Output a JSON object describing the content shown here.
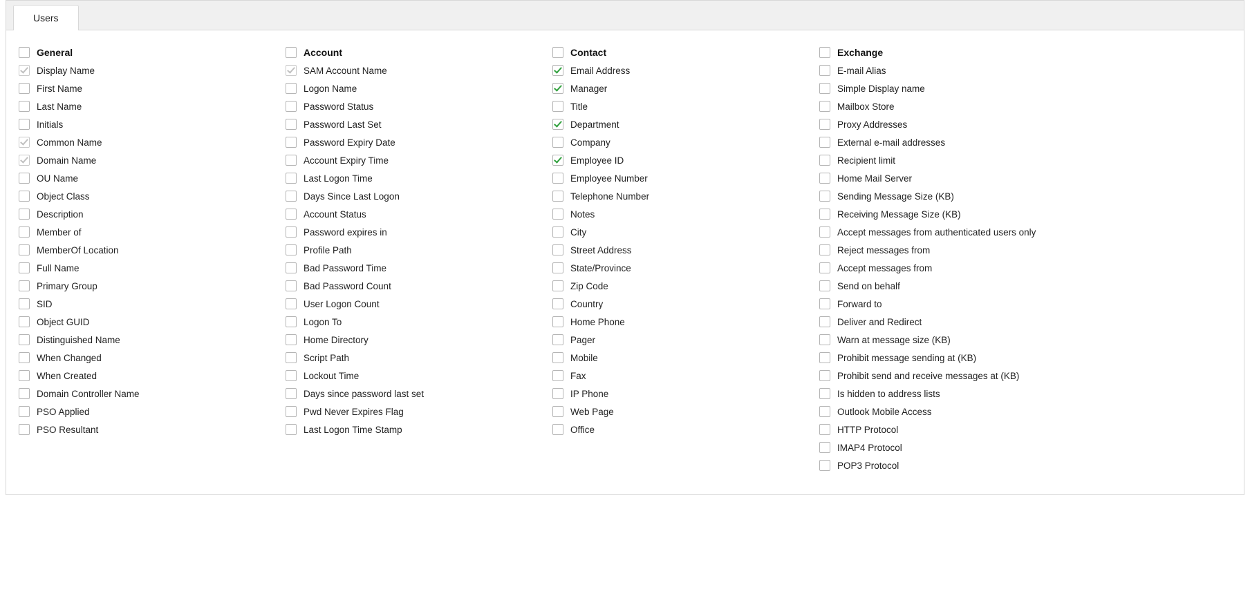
{
  "tab": {
    "label": "Users"
  },
  "columns": [
    {
      "key": "general",
      "title": "General",
      "items": [
        {
          "label": "Display Name",
          "state": "locked"
        },
        {
          "label": "First Name",
          "state": "unchecked"
        },
        {
          "label": "Last Name",
          "state": "unchecked"
        },
        {
          "label": "Initials",
          "state": "unchecked"
        },
        {
          "label": "Common Name",
          "state": "locked"
        },
        {
          "label": "Domain Name",
          "state": "locked"
        },
        {
          "label": "OU Name",
          "state": "unchecked"
        },
        {
          "label": "Object Class",
          "state": "unchecked"
        },
        {
          "label": "Description",
          "state": "unchecked"
        },
        {
          "label": "Member of",
          "state": "unchecked"
        },
        {
          "label": "MemberOf Location",
          "state": "unchecked"
        },
        {
          "label": "Full Name",
          "state": "unchecked"
        },
        {
          "label": "Primary Group",
          "state": "unchecked"
        },
        {
          "label": "SID",
          "state": "unchecked"
        },
        {
          "label": "Object GUID",
          "state": "unchecked"
        },
        {
          "label": "Distinguished Name",
          "state": "unchecked"
        },
        {
          "label": "When Changed",
          "state": "unchecked"
        },
        {
          "label": "When Created",
          "state": "unchecked"
        },
        {
          "label": "Domain Controller Name",
          "state": "unchecked"
        },
        {
          "label": "PSO Applied",
          "state": "unchecked"
        },
        {
          "label": "PSO Resultant",
          "state": "unchecked"
        }
      ]
    },
    {
      "key": "account",
      "title": "Account",
      "items": [
        {
          "label": "SAM Account Name",
          "state": "locked"
        },
        {
          "label": "Logon Name",
          "state": "unchecked"
        },
        {
          "label": "Password Status",
          "state": "unchecked"
        },
        {
          "label": "Password Last Set",
          "state": "unchecked"
        },
        {
          "label": "Password Expiry Date",
          "state": "unchecked"
        },
        {
          "label": "Account Expiry Time",
          "state": "unchecked"
        },
        {
          "label": "Last Logon Time",
          "state": "unchecked"
        },
        {
          "label": "Days Since Last Logon",
          "state": "unchecked"
        },
        {
          "label": "Account Status",
          "state": "unchecked"
        },
        {
          "label": "Password expires in",
          "state": "unchecked"
        },
        {
          "label": "Profile Path",
          "state": "unchecked"
        },
        {
          "label": "Bad Password Time",
          "state": "unchecked"
        },
        {
          "label": "Bad Password Count",
          "state": "unchecked"
        },
        {
          "label": "User Logon Count",
          "state": "unchecked"
        },
        {
          "label": "Logon To",
          "state": "unchecked"
        },
        {
          "label": "Home Directory",
          "state": "unchecked"
        },
        {
          "label": "Script Path",
          "state": "unchecked"
        },
        {
          "label": "Lockout Time",
          "state": "unchecked"
        },
        {
          "label": "Days since password last set",
          "state": "unchecked"
        },
        {
          "label": "Pwd Never Expires Flag",
          "state": "unchecked"
        },
        {
          "label": "Last Logon Time Stamp",
          "state": "unchecked"
        }
      ]
    },
    {
      "key": "contact",
      "title": "Contact",
      "items": [
        {
          "label": "Email Address",
          "state": "checked"
        },
        {
          "label": "Manager",
          "state": "checked"
        },
        {
          "label": "Title",
          "state": "unchecked"
        },
        {
          "label": "Department",
          "state": "checked"
        },
        {
          "label": "Company",
          "state": "unchecked"
        },
        {
          "label": "Employee ID",
          "state": "checked"
        },
        {
          "label": "Employee Number",
          "state": "unchecked"
        },
        {
          "label": "Telephone Number",
          "state": "unchecked"
        },
        {
          "label": "Notes",
          "state": "unchecked"
        },
        {
          "label": "City",
          "state": "unchecked"
        },
        {
          "label": "Street Address",
          "state": "unchecked"
        },
        {
          "label": "State/Province",
          "state": "unchecked"
        },
        {
          "label": "Zip Code",
          "state": "unchecked"
        },
        {
          "label": "Country",
          "state": "unchecked"
        },
        {
          "label": "Home Phone",
          "state": "unchecked"
        },
        {
          "label": "Pager",
          "state": "unchecked"
        },
        {
          "label": "Mobile",
          "state": "unchecked"
        },
        {
          "label": "Fax",
          "state": "unchecked"
        },
        {
          "label": "IP Phone",
          "state": "unchecked"
        },
        {
          "label": "Web Page",
          "state": "unchecked"
        },
        {
          "label": "Office",
          "state": "unchecked"
        }
      ]
    },
    {
      "key": "exchange",
      "title": "Exchange",
      "items": [
        {
          "label": "E-mail Alias",
          "state": "unchecked"
        },
        {
          "label": "Simple Display name",
          "state": "unchecked"
        },
        {
          "label": "Mailbox Store",
          "state": "unchecked"
        },
        {
          "label": "Proxy Addresses",
          "state": "unchecked"
        },
        {
          "label": "External e-mail addresses",
          "state": "unchecked"
        },
        {
          "label": "Recipient limit",
          "state": "unchecked"
        },
        {
          "label": "Home Mail Server",
          "state": "unchecked"
        },
        {
          "label": "Sending Message Size (KB)",
          "state": "unchecked"
        },
        {
          "label": "Receiving Message Size (KB)",
          "state": "unchecked"
        },
        {
          "label": "Accept messages from authenticated users only",
          "state": "unchecked"
        },
        {
          "label": "Reject messages from",
          "state": "unchecked"
        },
        {
          "label": "Accept messages from",
          "state": "unchecked"
        },
        {
          "label": "Send on behalf",
          "state": "unchecked"
        },
        {
          "label": "Forward to",
          "state": "unchecked"
        },
        {
          "label": "Deliver and Redirect",
          "state": "unchecked"
        },
        {
          "label": "Warn at message size (KB)",
          "state": "unchecked"
        },
        {
          "label": "Prohibit message sending at (KB)",
          "state": "unchecked"
        },
        {
          "label": "Prohibit send and receive messages at (KB)",
          "state": "unchecked"
        },
        {
          "label": "Is hidden to address lists",
          "state": "unchecked"
        },
        {
          "label": "Outlook Mobile Access",
          "state": "unchecked"
        },
        {
          "label": "HTTP Protocol",
          "state": "unchecked"
        },
        {
          "label": "IMAP4 Protocol",
          "state": "unchecked"
        },
        {
          "label": "POP3 Protocol",
          "state": "unchecked"
        }
      ]
    }
  ]
}
